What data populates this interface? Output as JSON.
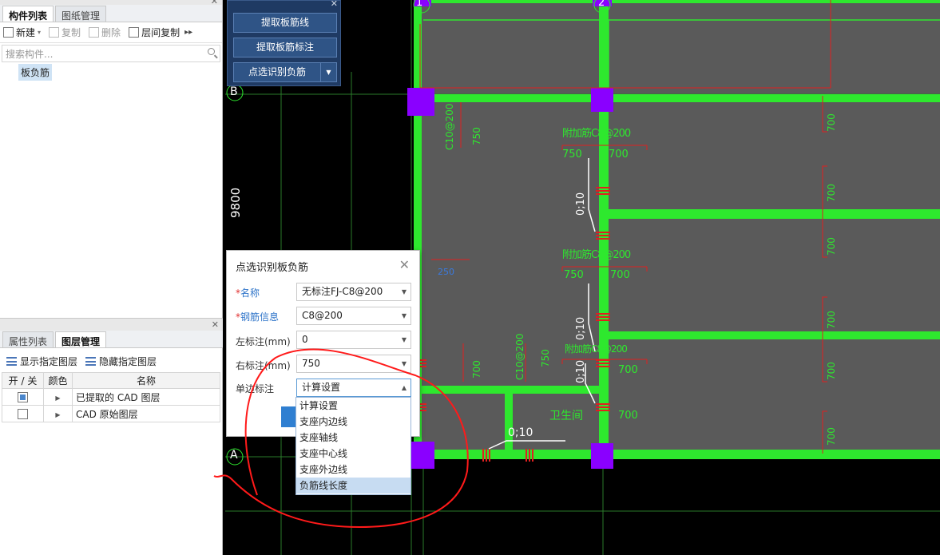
{
  "left_panel": {
    "top_tabs": [
      {
        "label": "构件列表",
        "active": true
      },
      {
        "label": "图纸管理",
        "active": false
      }
    ],
    "toolbar": {
      "new_label": "新建",
      "copy_label": "复制",
      "delete_label": "删除",
      "floor_copy_label": "层间复制",
      "more_icon": "double-chevron-right-icon"
    },
    "search_placeholder": "搜索构件...",
    "tree_items": [
      "板负筋"
    ],
    "bottom_tabs": [
      {
        "label": "属性列表",
        "active": false
      },
      {
        "label": "图层管理",
        "active": true
      }
    ],
    "layer_toolbar": {
      "show_label": "显示指定图层",
      "hide_label": "隐藏指定图层"
    },
    "layer_table": {
      "headers": [
        "开 / 关",
        "颜色",
        "名称"
      ],
      "rows": [
        {
          "checked": true,
          "name": "已提取的 CAD 图层"
        },
        {
          "checked": false,
          "name": "CAD 原始图层"
        }
      ]
    }
  },
  "float_panel": {
    "buttons": [
      "提取板筋线",
      "提取板筋标注",
      "点选识别负筋"
    ]
  },
  "dialog": {
    "title": "点选识别板负筋",
    "fields": [
      {
        "label": "名称",
        "required": true,
        "value": "无标注FJ-C8@200"
      },
      {
        "label": "钢筋信息",
        "required": true,
        "value": "C8@200"
      },
      {
        "label": "左标注(mm)",
        "required": false,
        "value": "0"
      },
      {
        "label": "右标注(mm)",
        "required": false,
        "value": "750"
      },
      {
        "label": "单边标注",
        "required": false,
        "value": "计算设置"
      }
    ],
    "dropdown_options": [
      "计算设置",
      "支座内边线",
      "支座轴线",
      "支座中心线",
      "支座外边线",
      "负筋线长度"
    ],
    "highlighted_option": "负筋线长度"
  },
  "cad_labels": {
    "axis_1": "1",
    "axis_2": "2",
    "axis_B": "B",
    "axis_A": "A",
    "dim_9800": "9800",
    "rebar_c10_left": "C10@200",
    "dim_750": "750",
    "dim_700": "700",
    "label_c8_top": "附加筋C8@200",
    "label_c8_mid": "附加筋C8@200",
    "label_c8_low": "附加筋C8@200",
    "label_c10_mid": "C10@200",
    "ratio": "0;10",
    "room_label": "卫生间",
    "dim_250": "250"
  },
  "colors": {
    "cad_background": "#000000",
    "cad_slab": "#5a5a5a",
    "cad_beam": "#2ee82e",
    "cad_column": "#8a00ff",
    "cad_dim_red": "#e02020",
    "annotation_circle": "#ff1a1a",
    "accent_blue": "#2f7fd1"
  }
}
